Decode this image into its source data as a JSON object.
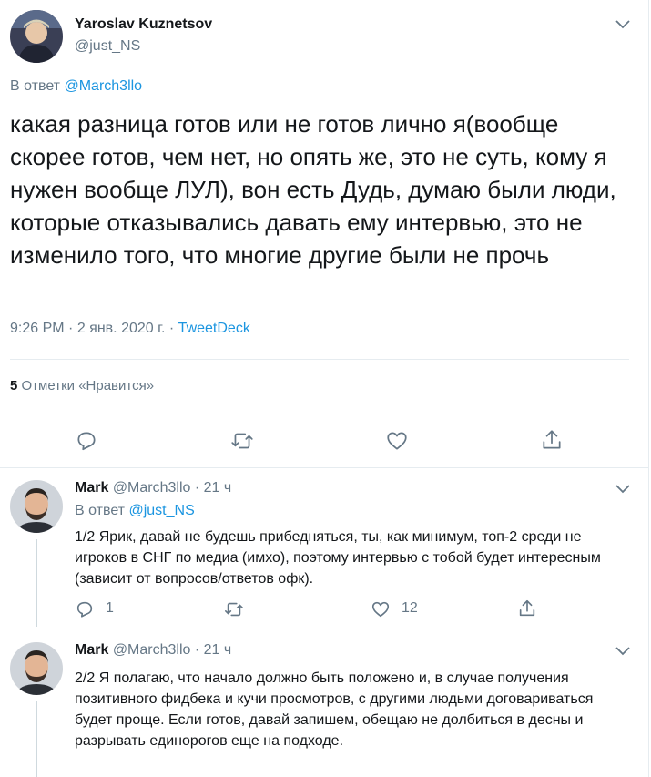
{
  "main_tweet": {
    "display_name": "Yaroslav Kuznetsov",
    "handle": "@just_NS",
    "reply_prefix": "В ответ",
    "reply_to": "@March3llo",
    "text": "какая разница готов или не готов лично я(вообще скорее готов, чем нет, но опять же, это не суть, кому я нужен вообще ЛУЛ), вон есть Дудь, думаю были люди, которые отказывались давать ему интервью, это не изменило того, что многие другие были не прочь",
    "time": "9:26 PM",
    "date": "2 янв. 2020 г.",
    "source": "TweetDeck",
    "likes_count": "5",
    "likes_label": "Отметки «Нравится»"
  },
  "replies": [
    {
      "display_name": "Mark",
      "handle": "@March3llo",
      "age": "21 ч",
      "reply_prefix": "В ответ",
      "reply_to": "@just_NS",
      "text": "1/2 Ярик, давай не будешь прибедняться, ты, как минимум, топ-2 среди не игроков в СНГ по медиа (имхо), поэтому интервью с тобой будет интересным (зависит от вопросов/ответов офк).",
      "reply_count": "1",
      "like_count": "12"
    },
    {
      "display_name": "Mark",
      "handle": "@March3llo",
      "age": "21 ч",
      "text": "2/2 Я полагаю, что начало должно быть положено и, в случае получения позитивного фидбека и кучи просмотров, с другими людьми договариваться будет проще. Если готов, давай запишем, обещаю не долбиться в десны и разрывать единорогов еще на подходе."
    }
  ],
  "separators": {
    "dot": "·"
  },
  "icons": {
    "reply": "reply-icon",
    "retweet": "retweet-icon",
    "like": "heart-icon",
    "share": "share-icon",
    "menu": "chevron-down-icon"
  },
  "colors": {
    "link": "#1b95e0",
    "muted": "#657786",
    "text": "#14171a",
    "divider": "#e6ecf0"
  }
}
